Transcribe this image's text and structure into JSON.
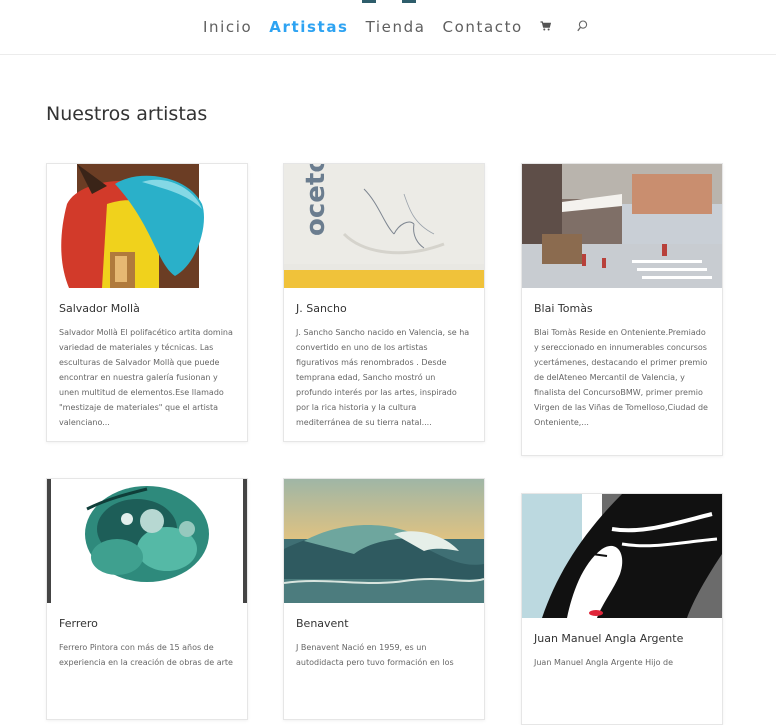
{
  "nav": {
    "items": [
      "Inicio",
      "Artistas",
      "Tienda",
      "Contacto"
    ],
    "active_index": 1,
    "cart_icon": "cart-icon",
    "search_icon": "search-icon",
    "accent_color": "#2ea3f2"
  },
  "page": {
    "title": "Nuestros artistas"
  },
  "artists": [
    {
      "name": "Salvador Mollà",
      "excerpt": "Salvador Mollà    El polifacético artita domina variedad de materiales y técnicas. Las esculturas de Salvador Mollà que puede encontrar en nuestra galería fusionan y unen multitud de elementos.Ese llamado \"mestizaje de materiales\" que el artista valenciano..."
    },
    {
      "name": "J. Sancho",
      "excerpt": "J. Sancho    Sancho nacido en Valencia, se ha convertido en uno de los artistas figurativos más  renombrados . Desde temprana edad, Sancho mostró un profundo interés por las artes, inspirado por la rica historia y la cultura mediterránea de su tierra natal...."
    },
    {
      "name": "Blai Tomàs",
      "excerpt": "Blai Tomàs    Reside en Onteniente.Premiado y sereccionado en innumerables concursos ycertámenes, destacando el primer premio de delAteneo Mercantil de Valencia, y finalista del ConcursoBMW, primer premio Virgen de las Viñas de Tomelloso,Ciudad de Onteniente,..."
    },
    {
      "name": "Ferrero",
      "excerpt": "Ferrero Pintora con más de 15 años de experiencia en la creación de obras de arte"
    },
    {
      "name": "Benavent",
      "excerpt": "J Benavent Nació en 1959, es un autodidacta pero tuvo formación en los"
    },
    {
      "name": "Juan Manuel Angla Argente",
      "excerpt": "Juan Manuel Angla Argente    Hijo de"
    }
  ]
}
